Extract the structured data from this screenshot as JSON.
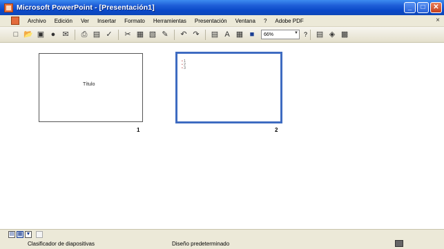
{
  "window": {
    "title": "Microsoft PowerPoint - [Presentación1]",
    "buttons": {
      "minimize": "_",
      "maximize": "□",
      "close": "✕"
    }
  },
  "menu": {
    "items": [
      {
        "label": "Archivo"
      },
      {
        "label": "Edición"
      },
      {
        "label": "Ver"
      },
      {
        "label": "Insertar"
      },
      {
        "label": "Formato"
      },
      {
        "label": "Herramientas"
      },
      {
        "label": "Presentación"
      },
      {
        "label": "Ventana"
      },
      {
        "label": "?"
      },
      {
        "label": "Adobe PDF"
      }
    ],
    "close_glyph": "×"
  },
  "toolbar": {
    "icons": [
      "new-icon",
      "open-icon",
      "save-icon",
      "permission-icon",
      "email-icon",
      "print-icon",
      "print-preview-icon",
      "spelling-icon",
      "cut-icon",
      "copy-icon",
      "paste-icon",
      "format-painter-icon",
      "undo-icon",
      "redo-icon",
      "chart-icon",
      "text-box-icon",
      "table-icon",
      "color-icon"
    ],
    "zoom_value": "66%",
    "help_glyph": "?"
  },
  "slides": [
    {
      "number": "1",
      "title": "Título",
      "bullets": []
    },
    {
      "number": "2",
      "title": "",
      "bullets": [
        "1",
        "2",
        "3"
      ]
    }
  ],
  "status": {
    "left": "Clasificador de diapositivas",
    "design": "Diseño predeterminado"
  },
  "colors": {
    "titlebar": "#0a48c8",
    "selected_border": "#3e6bc1",
    "chrome": "#ece9d8"
  }
}
